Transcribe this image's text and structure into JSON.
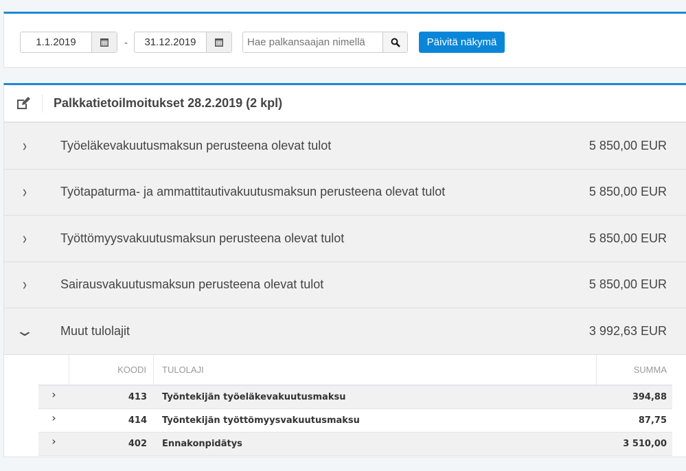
{
  "filters": {
    "start_date": "1.1.2019",
    "end_date": "31.12.2019",
    "separator": "-",
    "search_placeholder": "Hae palkansaajan nimellä",
    "update_label": "Päivitä näkymä"
  },
  "panel": {
    "title": "Palkkatietoilmoitukset 28.2.2019 (2 kpl)"
  },
  "rows": [
    {
      "label": "Työeläkevakuutusmaksun perusteena olevat tulot",
      "amount": "5 850,00 EUR",
      "chevron": "›"
    },
    {
      "label": "Työtapaturma- ja ammattitautivakuutusmaksun perusteena olevat tulot",
      "amount": "5 850,00 EUR",
      "chevron": "›"
    },
    {
      "label": "Työttömyysvakuutusmaksun perusteena olevat tulot",
      "amount": "5 850,00 EUR",
      "chevron": "›"
    },
    {
      "label": "Sairausvakuutusmaksun perusteena olevat tulot",
      "amount": "5 850,00 EUR",
      "chevron": "›"
    },
    {
      "label": "Muut tulolajit",
      "amount": "3 992,63 EUR",
      "chevron": "⌄"
    }
  ],
  "subtable": {
    "headers": {
      "code": "KOODI",
      "type": "TULOLAJI",
      "sum": "SUMMA"
    },
    "rows": [
      {
        "code": "413",
        "type": "Työntekijän työeläkevakuutusmaksu",
        "sum": "394,88"
      },
      {
        "code": "414",
        "type": "Työntekijän työttömyysvakuutusmaksu",
        "sum": "87,75"
      },
      {
        "code": "402",
        "type": "Ennakonpidätys",
        "sum": "3 510,00"
      }
    ]
  }
}
